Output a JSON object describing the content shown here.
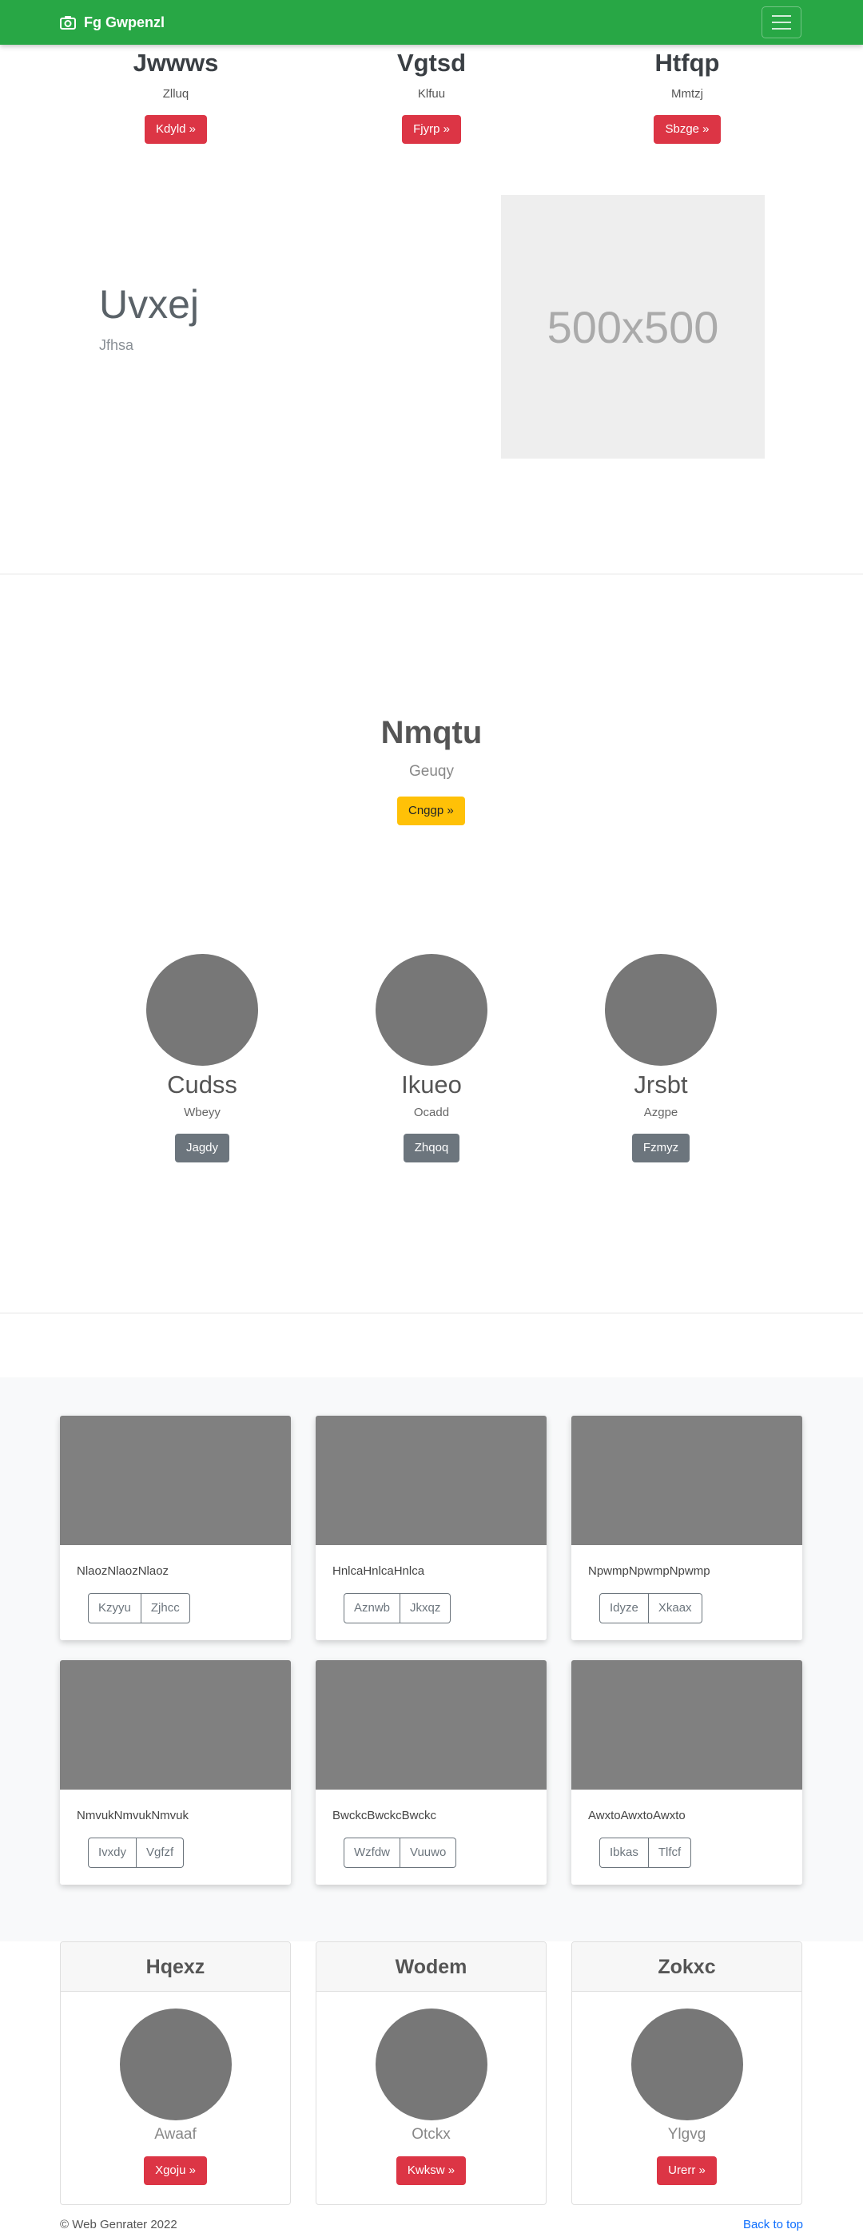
{
  "navbar": {
    "brand": "Fg Gwpenzl",
    "brand_icon": "camera-icon",
    "menu_icon": "hamburger-icon"
  },
  "top_columns": [
    {
      "title": "Jwwws",
      "subtitle": "Zlluq",
      "button": "Kdyld »"
    },
    {
      "title": "Vgtsd",
      "subtitle": "Klfuu",
      "button": "Fjyrp »"
    },
    {
      "title": "Htfqp",
      "subtitle": "Mmtzj",
      "button": "Sbzge »"
    }
  ],
  "feature": {
    "title": "Uvxej",
    "subtitle": "Jfhsa",
    "placeholder": "500x500"
  },
  "hero": {
    "title": "Nmqtu",
    "subtitle": "Geuqy",
    "button": "Cnggp »"
  },
  "people": [
    {
      "name": "Cudss",
      "subtitle": "Wbeyy",
      "button": "Jagdy"
    },
    {
      "name": "Ikueo",
      "subtitle": "Ocadd",
      "button": "Zhqoq"
    },
    {
      "name": "Jrsbt",
      "subtitle": "Azgpe",
      "button": "Fzmyz"
    }
  ],
  "album": [
    {
      "text": "NlaozNlaozNlaoz",
      "btn1": "Kzyyu",
      "btn2": "Zjhcc"
    },
    {
      "text": "HnlcaHnlcaHnlca",
      "btn1": "Aznwb",
      "btn2": "Jkxqz"
    },
    {
      "text": "NpwmpNpwmpNpwmp",
      "btn1": "Idyze",
      "btn2": "Xkaax"
    },
    {
      "text": "NmvukNmvukNmvuk",
      "btn1": "Ivxdy",
      "btn2": "Vgfzf"
    },
    {
      "text": "BwckcBwckcBwckc",
      "btn1": "Wzfdw",
      "btn2": "Vuuwo"
    },
    {
      "text": "AwxtoAwxtoAwxto",
      "btn1": "Ibkas",
      "btn2": "Tlfcf"
    }
  ],
  "pricing": [
    {
      "header": "Hqexz",
      "subtitle": "Awaaf",
      "button": "Xgoju »"
    },
    {
      "header": "Wodem",
      "subtitle": "Otckx",
      "button": "Kwksw »"
    },
    {
      "header": "Zokxc",
      "subtitle": "Ylgvg",
      "button": "Urerr »"
    }
  ],
  "footer": {
    "copyright": "© Web Genrater 2022",
    "back_to_top": "Back to top"
  },
  "colors": {
    "navbar": "#28a745",
    "danger": "#dc3545",
    "warning": "#ffc107",
    "secondary": "#6c757d",
    "link": "#0d6efd"
  }
}
